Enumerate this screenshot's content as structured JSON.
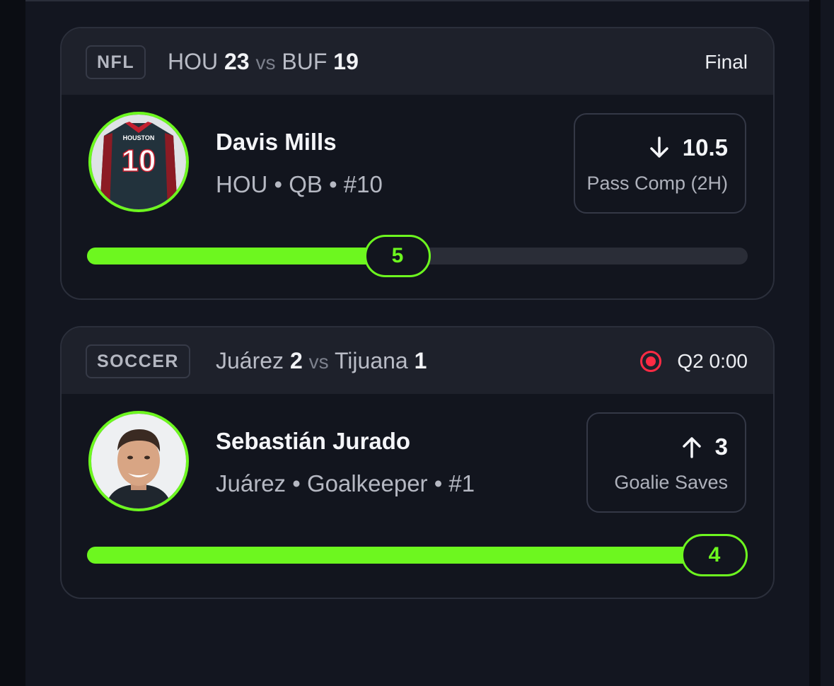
{
  "cards": [
    {
      "league": "NFL",
      "home_team": "HOU",
      "home_score": "23",
      "vs": "vs",
      "away_team": "BUF",
      "away_score": "19",
      "status": "Final",
      "player": {
        "name": "Davis Mills",
        "meta": "HOU • QB • #10",
        "jersey_text": "HOUSTON",
        "jersey_number": "10"
      },
      "prop": {
        "direction": "under",
        "direction_icon": "arrow-down-icon",
        "line": "10.5",
        "label": "Pass Comp (2H)"
      },
      "progress": {
        "current": "5",
        "fraction": 0.47
      }
    },
    {
      "league": "SOCCER",
      "home_team": "Juárez",
      "home_score": "2",
      "vs": "vs",
      "away_team": "Tijuana",
      "away_score": "1",
      "status": "Q2 0:00",
      "status_icon": "live-record-icon",
      "player": {
        "name": "Sebastián Jurado",
        "meta": "Juárez • Goalkeeper • #1"
      },
      "prop": {
        "direction": "over",
        "direction_icon": "arrow-up-icon",
        "line": "3",
        "label": "Goalie Saves"
      },
      "progress": {
        "current": "4",
        "fraction": 1.0
      }
    }
  ],
  "colors": {
    "accent": "#6df71f",
    "live": "#ff2b44",
    "card_bg": "#12151e",
    "header_bg": "#1e212b"
  }
}
